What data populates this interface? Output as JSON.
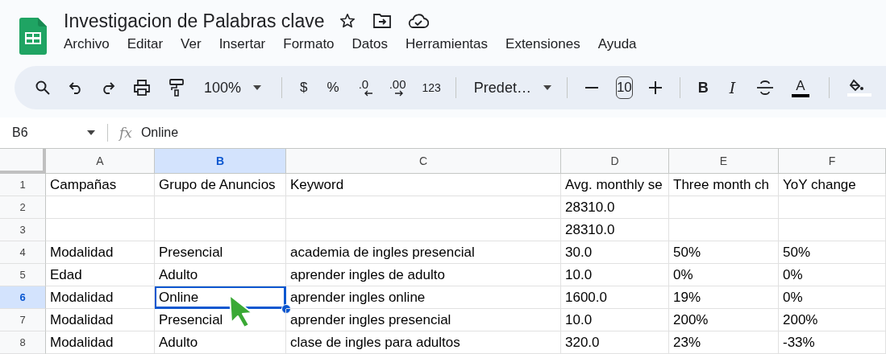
{
  "document": {
    "title": "Investigacion de Palabras clave"
  },
  "menu": [
    "Archivo",
    "Editar",
    "Ver",
    "Insertar",
    "Formato",
    "Datos",
    "Herramientas",
    "Extensiones",
    "Ayuda"
  ],
  "toolbar": {
    "zoom": "100%",
    "currency": "$",
    "percent": "%",
    "decrease_decimal": ".0",
    "increase_decimal": ".00",
    "number_format": "123",
    "font": "Predet…",
    "font_size": "10",
    "bold": "B",
    "italic": "I",
    "text_color": "A"
  },
  "formula_bar": {
    "name_box": "B6",
    "fx": "fx",
    "value": "Online"
  },
  "columns": [
    {
      "label": "A",
      "selected": false
    },
    {
      "label": "B",
      "selected": true
    },
    {
      "label": "C",
      "selected": false
    },
    {
      "label": "D",
      "selected": false
    },
    {
      "label": "E",
      "selected": false
    },
    {
      "label": "F",
      "selected": false
    }
  ],
  "rows": [
    {
      "number": "1",
      "selected": false,
      "cells": [
        {
          "text": "Campañas",
          "selected": false
        },
        {
          "text": "Grupo de Anuncios",
          "selected": false
        },
        {
          "text": "Keyword",
          "selected": false
        },
        {
          "text": "Avg. monthly se",
          "selected": false
        },
        {
          "text": "Three month ch",
          "selected": false
        },
        {
          "text": "YoY change",
          "selected": false
        }
      ]
    },
    {
      "number": "2",
      "selected": false,
      "cells": [
        {
          "selected": false
        },
        {
          "selected": false
        },
        {
          "selected": false
        },
        {
          "text": "28310.0",
          "selected": false
        },
        {
          "selected": false
        },
        {
          "selected": false
        }
      ]
    },
    {
      "number": "3",
      "selected": false,
      "cells": [
        {
          "selected": false
        },
        {
          "selected": false
        },
        {
          "selected": false
        },
        {
          "text": "28310.0",
          "selected": false
        },
        {
          "selected": false
        },
        {
          "selected": false
        }
      ]
    },
    {
      "number": "4",
      "selected": false,
      "cells": [
        {
          "text": "Modalidad",
          "selected": false
        },
        {
          "text": "Presencial",
          "selected": false
        },
        {
          "text": "academia de ingles presencial",
          "selected": false
        },
        {
          "text": "30.0",
          "selected": false
        },
        {
          "text": "50%",
          "selected": false
        },
        {
          "text": "50%",
          "selected": false
        }
      ]
    },
    {
      "number": "5",
      "selected": false,
      "cells": [
        {
          "text": "Edad",
          "selected": false
        },
        {
          "text": "Adulto",
          "selected": false
        },
        {
          "text": "aprender ingles de adulto",
          "selected": false
        },
        {
          "text": "10.0",
          "selected": false
        },
        {
          "text": "0%",
          "selected": false
        },
        {
          "text": "0%",
          "selected": false
        }
      ]
    },
    {
      "number": "6",
      "selected": true,
      "cells": [
        {
          "text": "Modalidad",
          "selected": false
        },
        {
          "text": "Online",
          "selected": true
        },
        {
          "text": "aprender ingles online",
          "selected": false
        },
        {
          "text": "1600.0",
          "selected": false
        },
        {
          "text": "19%",
          "selected": false
        },
        {
          "text": "0%",
          "selected": false
        }
      ]
    },
    {
      "number": "7",
      "selected": false,
      "cells": [
        {
          "text": "Modalidad",
          "selected": false
        },
        {
          "text": "Presencial",
          "selected": false
        },
        {
          "text": "aprender ingles presencial",
          "selected": false
        },
        {
          "text": "10.0",
          "selected": false
        },
        {
          "text": "200%",
          "selected": false
        },
        {
          "text": "200%",
          "selected": false
        }
      ]
    },
    {
      "number": "8",
      "selected": false,
      "cells": [
        {
          "text": "Modalidad",
          "selected": false
        },
        {
          "text": "Adulto",
          "selected": false
        },
        {
          "text": "clase de ingles para adultos",
          "selected": false
        },
        {
          "text": "320.0",
          "selected": false
        },
        {
          "text": "23%",
          "selected": false
        },
        {
          "text": "-33%",
          "selected": false
        }
      ]
    }
  ]
}
